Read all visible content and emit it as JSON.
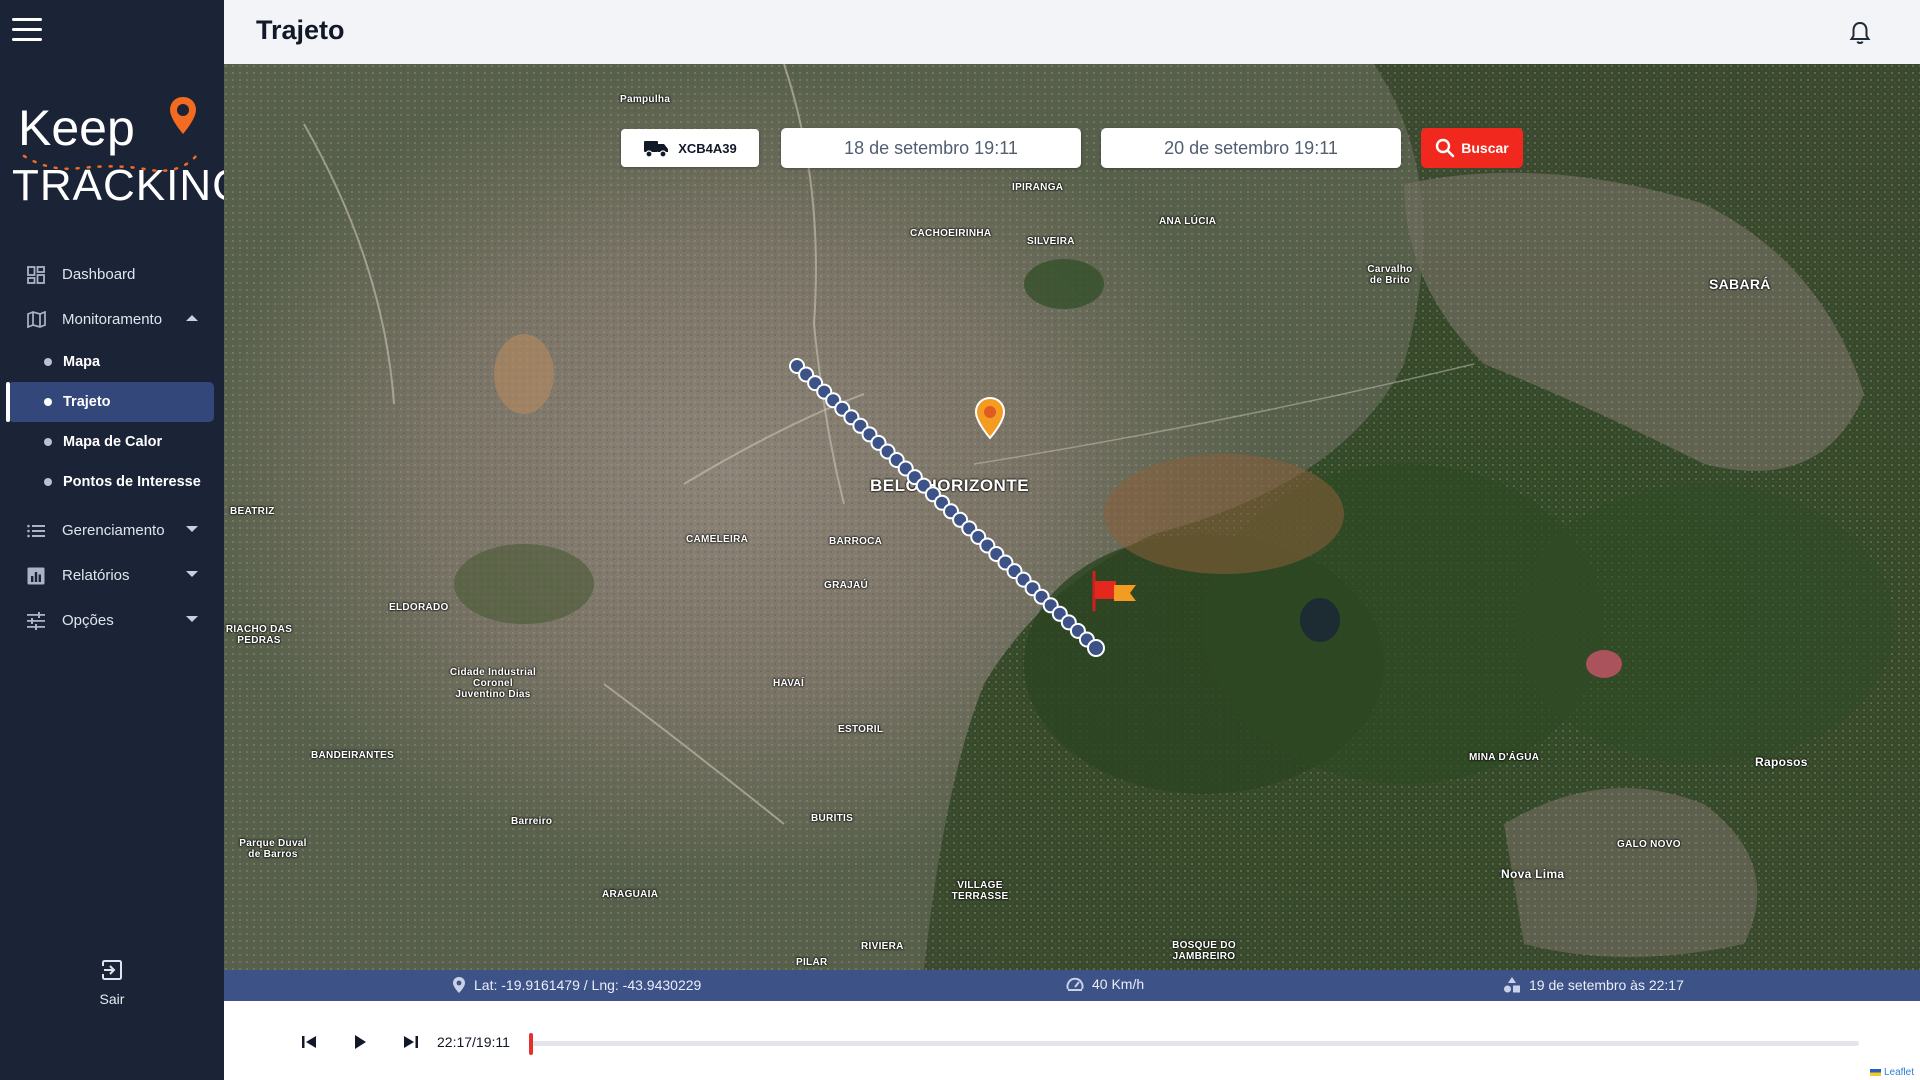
{
  "app": {
    "logo_line1": "Keep",
    "logo_line2": "TRACKING",
    "brand_color": "#f26b21"
  },
  "header": {
    "title": "Trajeto"
  },
  "sidebar": {
    "items": [
      {
        "label": "Dashboard",
        "icon": "dashboard-icon"
      },
      {
        "label": "Monitoramento",
        "icon": "map-icon",
        "expanded": true
      },
      {
        "label": "Gerenciamento",
        "icon": "list-icon",
        "expanded": false
      },
      {
        "label": "Relatórios",
        "icon": "bar-chart-icon",
        "expanded": false
      },
      {
        "label": "Opções",
        "icon": "sliders-icon",
        "expanded": false
      }
    ],
    "monitoramento_sub": [
      {
        "label": "Mapa",
        "active": false
      },
      {
        "label": "Trajeto",
        "active": true
      },
      {
        "label": "Mapa de Calor",
        "active": false
      },
      {
        "label": "Pontos de Interesse",
        "active": false
      }
    ],
    "logout_label": "Sair"
  },
  "filters": {
    "vehicle_plate": "XCB4A39",
    "start_date": "18 de setembro 19:11",
    "end_date": "20 de setembro 19:11",
    "search_label": "Buscar",
    "search_color": "#f0281e"
  },
  "map": {
    "city_label": "BELO HORIZONTE",
    "labels": [
      {
        "text": "Pampulha"
      },
      {
        "text": "IPIRANGA"
      },
      {
        "text": "CACHOEIRINHA"
      },
      {
        "text": "SILVEIRA"
      },
      {
        "text": "ANA LÚCIA"
      },
      {
        "text": "Carvalho de Brito"
      },
      {
        "text": "SABARÁ"
      },
      {
        "text": "BEATRIZ"
      },
      {
        "text": "CAMELEIRA"
      },
      {
        "text": "BARROCA"
      },
      {
        "text": "GRAJAÚ"
      },
      {
        "text": "ELDORADO"
      },
      {
        "text": "RIACHO DAS PEDRAS"
      },
      {
        "text": "Cidade Industrial Coronel Juventino Dias"
      },
      {
        "text": "HAVAÍ"
      },
      {
        "text": "ESTORIL"
      },
      {
        "text": "BANDEIRANTES"
      },
      {
        "text": "Barreiro"
      },
      {
        "text": "BURITIS"
      },
      {
        "text": "Parque Duval de Barros"
      },
      {
        "text": "ARAGUAIA"
      },
      {
        "text": "VILLAGE TERRASSE"
      },
      {
        "text": "RIVIERA"
      },
      {
        "text": "PILAR"
      },
      {
        "text": "BOSQUE DO JAMBREIRO"
      },
      {
        "text": "MINA D'ÁGUA"
      },
      {
        "text": "Raposos"
      },
      {
        "text": "GALO NOVO"
      },
      {
        "text": "Nova Lima"
      }
    ],
    "attribution": "Leaflet"
  },
  "infobar": {
    "coords": "Lat: -19.9161479 / Lng: -43.9430229",
    "speed": "40 Km/h",
    "timestamp": "19 de setembro às 22:17"
  },
  "player": {
    "time": "22:17/19:11",
    "progress_fraction": 0.0
  }
}
